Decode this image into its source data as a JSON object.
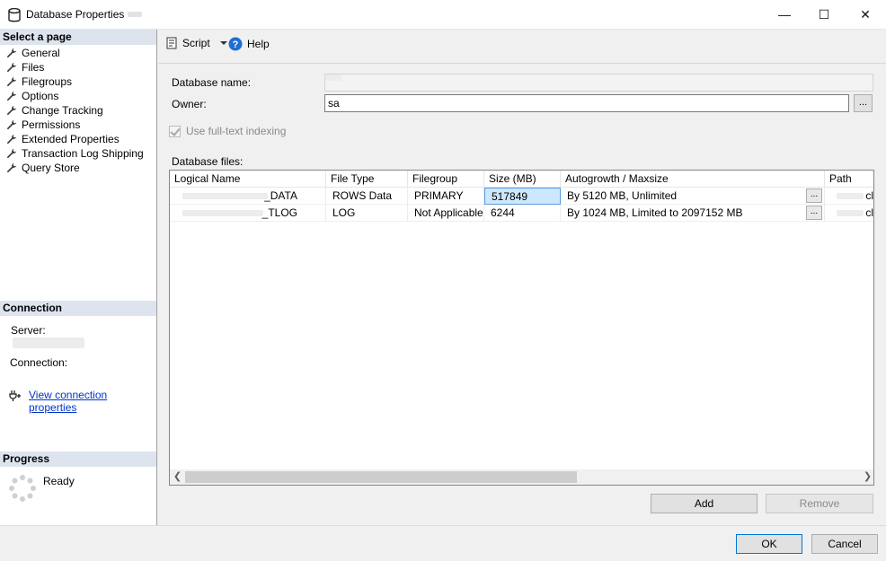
{
  "window": {
    "title": "Database Properties -",
    "controls": {
      "minimize": "—",
      "maximize": "☐",
      "close": "✕"
    }
  },
  "left_panel": {
    "select_page_header": "Select a page",
    "pages": [
      {
        "label": "General"
      },
      {
        "label": "Files"
      },
      {
        "label": "Filegroups"
      },
      {
        "label": "Options"
      },
      {
        "label": "Change Tracking"
      },
      {
        "label": "Permissions"
      },
      {
        "label": "Extended Properties"
      },
      {
        "label": "Transaction Log Shipping"
      },
      {
        "label": "Query Store"
      }
    ],
    "selected_page": "Files",
    "connection_header": "Connection",
    "server_label": "Server:",
    "connection_label": "Connection:",
    "view_connection_link": "View connection properties",
    "progress_header": "Progress",
    "progress_status": "Ready"
  },
  "toolbar": {
    "script_label": "Script",
    "help_label": "Help"
  },
  "form": {
    "database_name_label": "Database name:",
    "owner_label": "Owner:",
    "owner_value": "sa",
    "browse_button": "...",
    "fulltext_label": "Use full-text indexing",
    "fulltext_checked": true,
    "database_files_label": "Database files:"
  },
  "files_grid": {
    "columns": [
      "Logical Name",
      "File Type",
      "Filegroup",
      "Size (MB)",
      "Autogrowth / Maxsize",
      "Path"
    ],
    "rows": [
      {
        "logical_name": "_DATA",
        "file_type": "ROWS Data",
        "filegroup": "PRIMARY",
        "size_mb": "517849",
        "autogrowth": "By 5120 MB, Unlimited",
        "button": "...",
        "path": "cl"
      },
      {
        "logical_name": "_TLOG",
        "file_type": "LOG",
        "filegroup": "Not Applicable",
        "size_mb": "6244",
        "autogrowth": "By 1024 MB, Limited to 2097152 MB",
        "button": "...",
        "path": "cl"
      }
    ]
  },
  "buttons": {
    "add": "Add",
    "remove": "Remove",
    "ok": "OK",
    "cancel": "Cancel"
  },
  "colors": {
    "section_header_bg": "#dde4ee",
    "selection_bg": "#cce8ff",
    "link": "#0033cc",
    "help_icon": "#1e6fd0"
  }
}
